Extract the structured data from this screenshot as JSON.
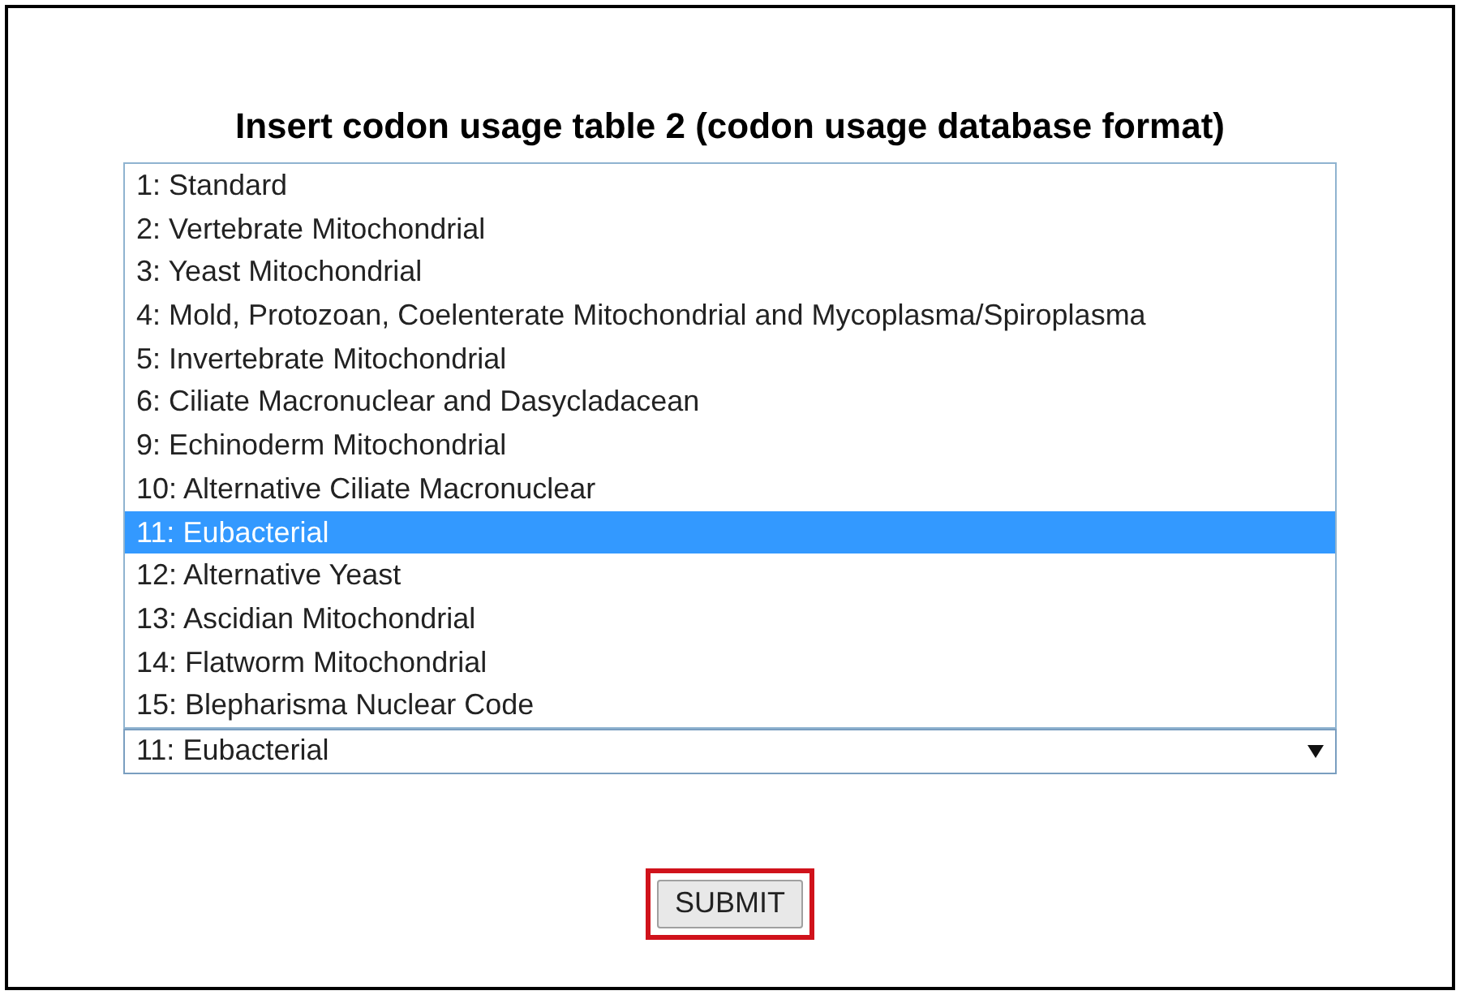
{
  "title": "Insert codon usage table 2 (codon usage database format)",
  "listbox": {
    "options": [
      {
        "label": "1: Standard",
        "selected": false
      },
      {
        "label": "2: Vertebrate Mitochondrial",
        "selected": false
      },
      {
        "label": "3: Yeast Mitochondrial",
        "selected": false
      },
      {
        "label": "4: Mold, Protozoan, Coelenterate Mitochondrial and Mycoplasma/Spiroplasma",
        "selected": false
      },
      {
        "label": "5: Invertebrate Mitochondrial",
        "selected": false
      },
      {
        "label": "6: Ciliate Macronuclear and Dasycladacean",
        "selected": false
      },
      {
        "label": "9: Echinoderm Mitochondrial",
        "selected": false
      },
      {
        "label": "10: Alternative Ciliate Macronuclear",
        "selected": false
      },
      {
        "label": "11: Eubacterial",
        "selected": true
      },
      {
        "label": "12: Alternative Yeast",
        "selected": false
      },
      {
        "label": "13: Ascidian Mitochondrial",
        "selected": false
      },
      {
        "label": "14: Flatworm Mitochondrial",
        "selected": false
      },
      {
        "label": "15: Blepharisma Nuclear Code",
        "selected": false
      }
    ]
  },
  "dropdown": {
    "value": "11: Eubacterial"
  },
  "submit": {
    "label": "SUBMIT",
    "highlighted": true
  }
}
